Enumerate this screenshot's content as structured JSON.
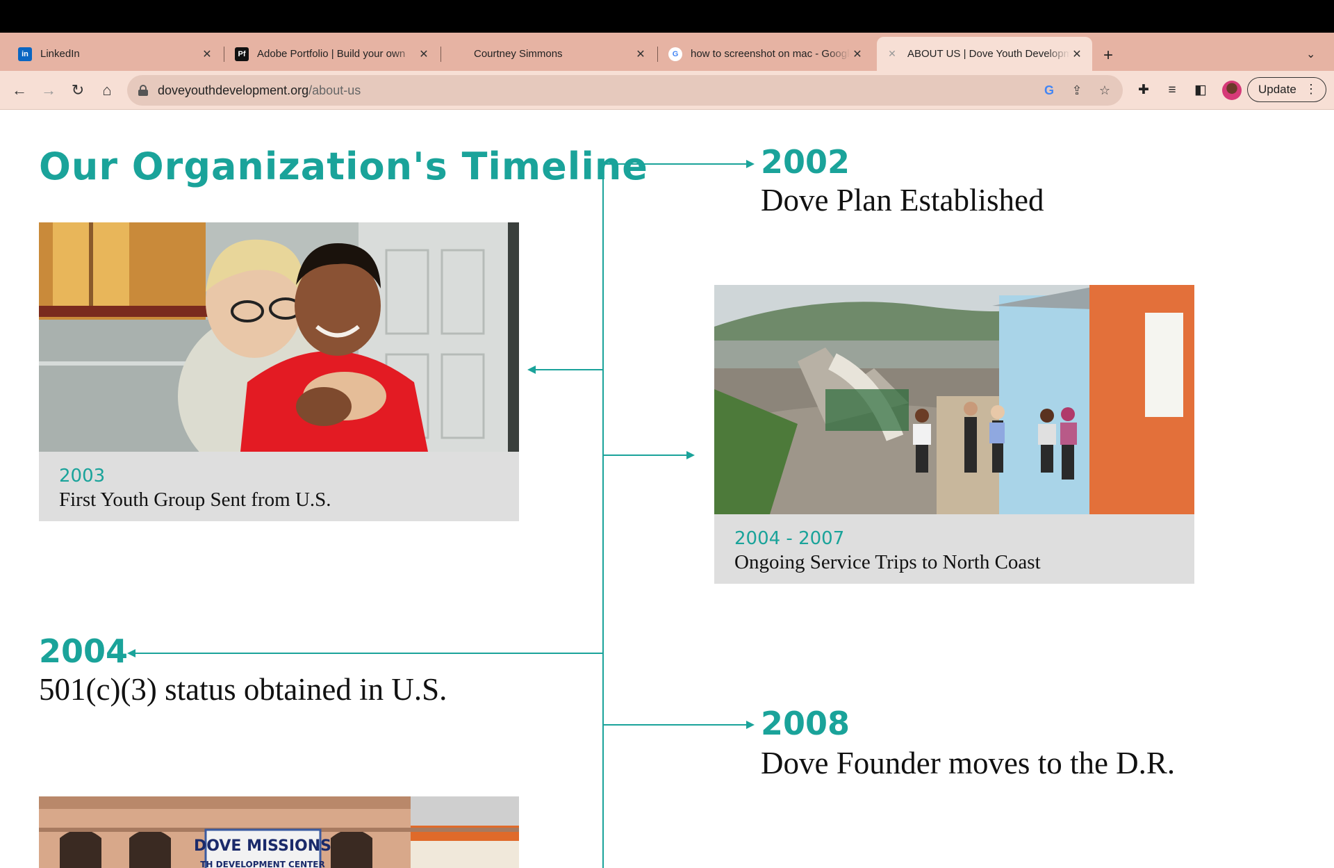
{
  "browser": {
    "tabs": [
      {
        "title": "LinkedIn",
        "favicon": "linkedin-icon",
        "active": false
      },
      {
        "title": "Adobe Portfolio | Build your own",
        "favicon": "adobe-portfolio-icon",
        "active": false
      },
      {
        "title": "Courtney Simmons",
        "favicon": "",
        "active": false
      },
      {
        "title": "how to screenshot on mac - Google",
        "favicon": "google-icon",
        "active": false
      },
      {
        "title": "ABOUT US | Dove Youth Development",
        "favicon": "dove-icon",
        "active": true
      }
    ],
    "favicon_labels": {
      "linkedin": "in",
      "portfolio": "Pf",
      "google": "G"
    },
    "new_tab": "+",
    "url_domain": "doveyouthdevelopment.org",
    "url_path": "/about-us",
    "update_label": "Update",
    "colors": {
      "tabstrip": "#e6b3a3",
      "toolbar": "#f7dfd5",
      "omnibox": "#e6c9bd"
    }
  },
  "page": {
    "title": "Our Organization's Timeline",
    "accent_color": "#1aa39a",
    "events": [
      {
        "year": "2002",
        "text": "Dove Plan Established"
      },
      {
        "year": "2003",
        "text": "First Youth Group Sent from U.S."
      },
      {
        "year": "2004 - 2007",
        "text": "Ongoing Service Trips to North Coast"
      },
      {
        "year": "2004",
        "text": "501(c)(3) status obtained in U.S."
      },
      {
        "year": "2008",
        "text": "Dove Founder moves to the D.R."
      }
    ],
    "banner_text": {
      "line1": "DOVE MISSIONS",
      "line2": "TH DEVELOPMENT CENTER"
    }
  }
}
